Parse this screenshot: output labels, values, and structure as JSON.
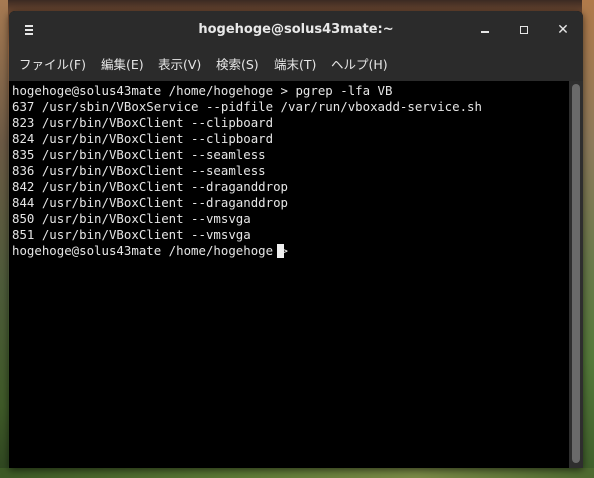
{
  "window": {
    "title": "hogehoge@solus43mate:~",
    "close_glyph": "✕"
  },
  "menubar": {
    "items": [
      {
        "label": "ファイル(F)"
      },
      {
        "label": "編集(E)"
      },
      {
        "label": "表示(V)"
      },
      {
        "label": "検索(S)"
      },
      {
        "label": "端末(T)"
      },
      {
        "label": "ヘルプ(H)"
      }
    ]
  },
  "terminal": {
    "lines": [
      "hogehoge@solus43mate /home/hogehoge > pgrep -lfa VB",
      "637 /usr/sbin/VBoxService --pidfile /var/run/vboxadd-service.sh",
      "823 /usr/bin/VBoxClient --clipboard",
      "824 /usr/bin/VBoxClient --clipboard",
      "835 /usr/bin/VBoxClient --seamless",
      "836 /usr/bin/VBoxClient --seamless",
      "842 /usr/bin/VBoxClient --draganddrop",
      "844 /usr/bin/VBoxClient --draganddrop",
      "850 /usr/bin/VBoxClient --vmsvga",
      "851 /usr/bin/VBoxClient --vmsvga",
      "hogehoge@solus43mate /home/hogehoge > "
    ]
  },
  "colors": {
    "titlebar": "#2b2b2b",
    "terminal_bg": "#000000",
    "terminal_fg": "#e6e6e6"
  },
  "icons": {
    "menu": "hamburger-menu-icon",
    "minimize": "minimize-icon",
    "maximize": "maximize-icon",
    "close": "close-icon"
  }
}
